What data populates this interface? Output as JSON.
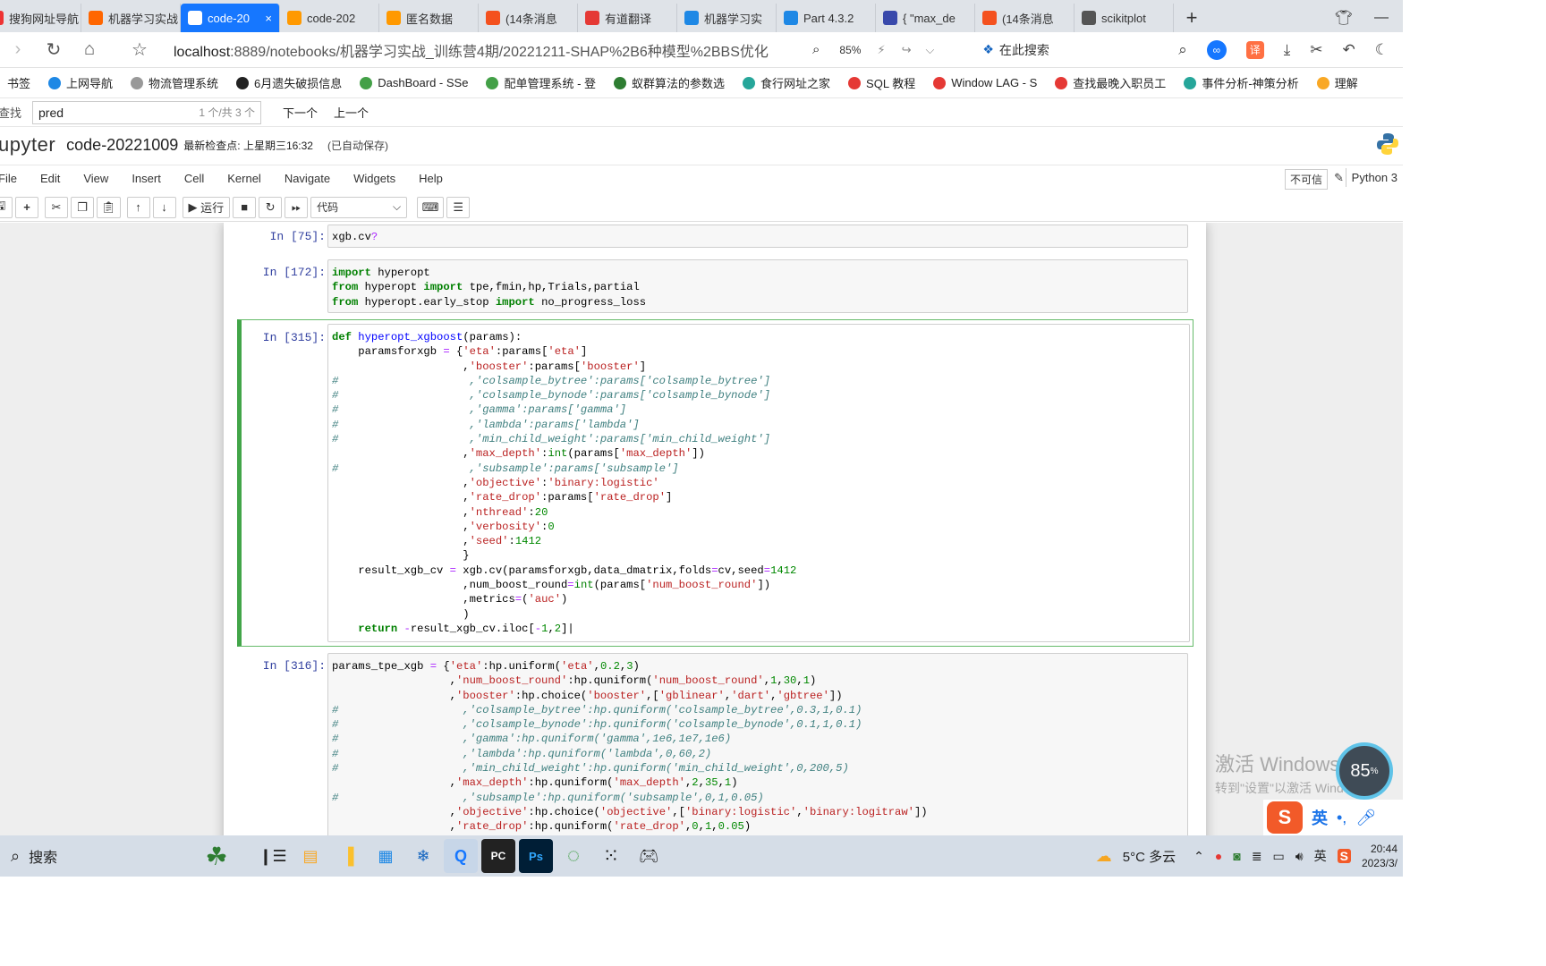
{
  "browser": {
    "tabs": [
      {
        "label": "搜狗网址导航",
        "color": "#e33"
      },
      {
        "label": "机器学习实战",
        "color": "#f60"
      },
      {
        "label": "code-20",
        "color": "#f90",
        "active": true
      },
      {
        "label": "code-202",
        "color": "#f90"
      },
      {
        "label": "匿名数据",
        "color": "#f90"
      },
      {
        "label": "(14条消息",
        "color": "#f4511e"
      },
      {
        "label": "有道翻译",
        "color": "#e53935"
      },
      {
        "label": "机器学习实",
        "color": "#1e88e5"
      },
      {
        "label": "Part 4.3.2",
        "color": "#1e88e5"
      },
      {
        "label": "{ \"max_de",
        "color": "#3949ab"
      },
      {
        "label": "(14条消息",
        "color": "#f4511e"
      },
      {
        "label": "scikitplot",
        "color": "#555"
      }
    ],
    "new_tab": "+",
    "url_host": "localhost",
    "url_path": ":8889/notebooks/机器学习实战_训练营4期/20221211-SHAP%2B6种模型%2BBS优化",
    "zoom": "85%",
    "search_placeholder": "在此搜索",
    "bookmarks": [
      {
        "label": "书签",
        "color": "transparent"
      },
      {
        "label": "上网导航",
        "color": "#1e88e5"
      },
      {
        "label": "物流管理系统",
        "color": "#999"
      },
      {
        "label": "6月遗失破损信息",
        "color": "#222"
      },
      {
        "label": "DashBoard - SSe",
        "color": "#43a047"
      },
      {
        "label": "配单管理系统 - 登",
        "color": "#43a047"
      },
      {
        "label": "蚁群算法的参数选",
        "color": "#2e7d32"
      },
      {
        "label": "食行网址之家",
        "color": "#26a69a"
      },
      {
        "label": "SQL 教程",
        "color": "#e53935"
      },
      {
        "label": "Window LAG - S",
        "color": "#e53935"
      },
      {
        "label": "查找最晚入职员工",
        "color": "#e53935"
      },
      {
        "label": "事件分析-神策分析",
        "color": "#26a69a"
      },
      {
        "label": "理解",
        "color": "#f9a825"
      }
    ],
    "find": {
      "label": "查找",
      "query": "pred",
      "count": "1 个/共 3 个",
      "next": "下一个",
      "prev": "上一个"
    }
  },
  "jupyter": {
    "logo_text": "upyter",
    "notebook_name": "code-20221009",
    "checkpoint": "最新检查点: 上星期三16:32",
    "autosave": "(已自动保存)",
    "menu": [
      "File",
      "Edit",
      "View",
      "Insert",
      "Cell",
      "Kernel",
      "Navigate",
      "Widgets",
      "Help"
    ],
    "trusted": "不可信",
    "kernel": "Python 3",
    "run_label": "运行",
    "cell_type": "代码",
    "cells": [
      {
        "prompt": "In  [75]:"
      },
      {
        "prompt": "In  [172]:"
      },
      {
        "prompt": "In  [315]:"
      },
      {
        "prompt": "In  [316]:"
      }
    ]
  },
  "overlay": {
    "watermark_line1": "激活 Windows",
    "watermark_line2": "转到\"设置\"以激活 Windows。",
    "speed": "85",
    "ime_lang": "英"
  },
  "taskbar": {
    "search": "搜索",
    "weather": "5°C 多云",
    "lang": "英",
    "time": "20:44",
    "date": "2023/3/"
  }
}
